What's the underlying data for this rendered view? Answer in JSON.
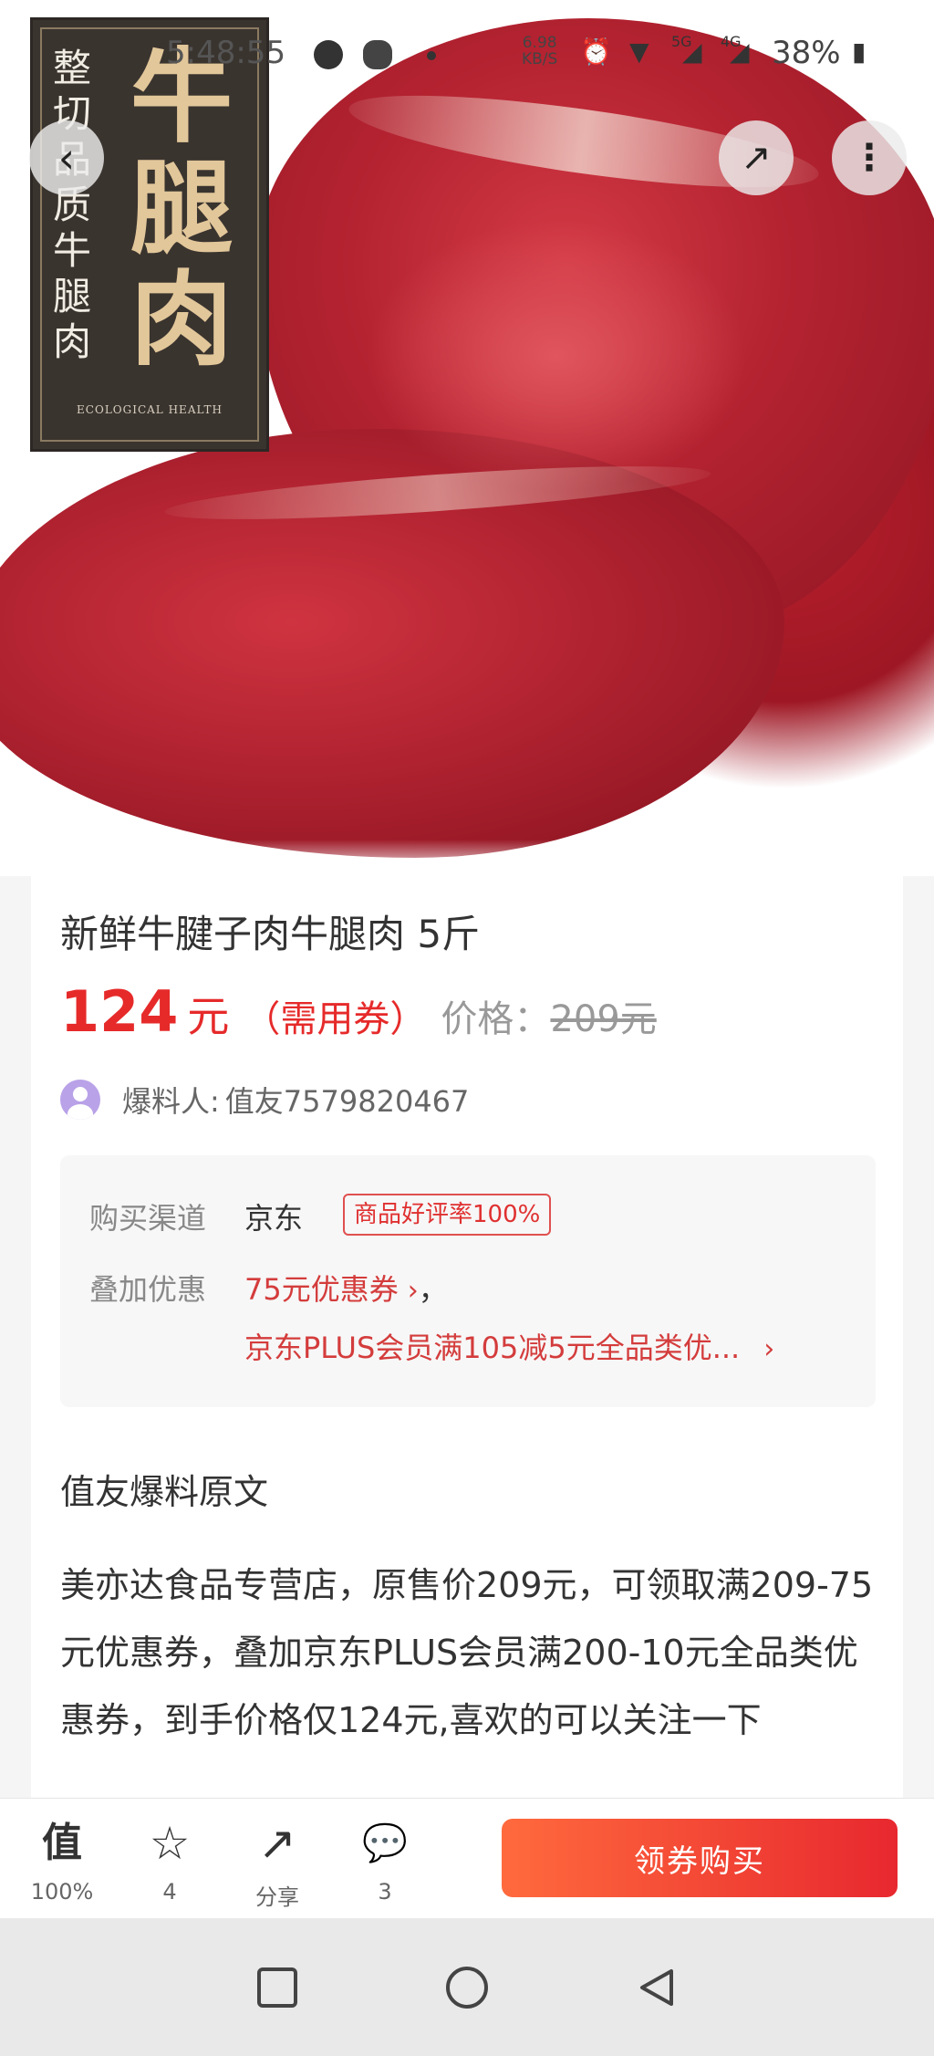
{
  "status_bar": {
    "time": "5:48:55",
    "network_speed_value": "6.98",
    "network_speed_unit": "KB/S",
    "network_5g": "5G",
    "network_4g": "4G",
    "battery": "38%"
  },
  "hero": {
    "label_small_text": "整切品质牛腿肉",
    "label_big_text": "牛腿肉",
    "label_english": "ECOLOGICAL HEALTH"
  },
  "product": {
    "title": "新鲜牛腱子肉牛腿肉 5斤",
    "price": "124",
    "price_unit": "元",
    "coupon_note": "（需用券）",
    "original_label": "价格：",
    "original_price": "209元"
  },
  "reporter": {
    "label": "爆料人:",
    "name": "值友7579820467"
  },
  "channel": {
    "buy_channel_label": "购买渠道",
    "buy_channel_value": "京东",
    "rating_badge": "商品好评率100%",
    "stack_label": "叠加优惠",
    "promo1": "75元优惠券",
    "promo1_arrow": "›",
    "promo1_suffix": "，",
    "promo2": "京东PLUS会员满105减5元全品类优...",
    "promo2_arrow": "›"
  },
  "original_text": {
    "heading": "值友爆料原文",
    "body": "美亦达食品专营店，原售价209元，可领取满209-75元优惠券，叠加京东PLUS会员满200-10元全品类优惠券，到手价格仅124元,喜欢的可以关注一下"
  },
  "action_bar": {
    "worth": {
      "icon": "值",
      "label": "100%"
    },
    "favorite": {
      "icon": "☆",
      "label": "4"
    },
    "share": {
      "icon": "↗",
      "label": "分享"
    },
    "comment": {
      "icon": "💬",
      "label": "3"
    },
    "buy_button": "领券购买"
  },
  "colors": {
    "accent_red": "#e62a2a",
    "button_gradient_start": "#ff6a3d",
    "button_gradient_end": "#e8282f"
  },
  "icons": [
    "back-arrow-icon",
    "share-icon",
    "more-vertical-icon",
    "avatar-icon",
    "worth-icon",
    "star-icon",
    "share-edit-icon",
    "comment-icon",
    "nav-square-icon",
    "nav-circle-icon",
    "nav-triangle-icon"
  ]
}
